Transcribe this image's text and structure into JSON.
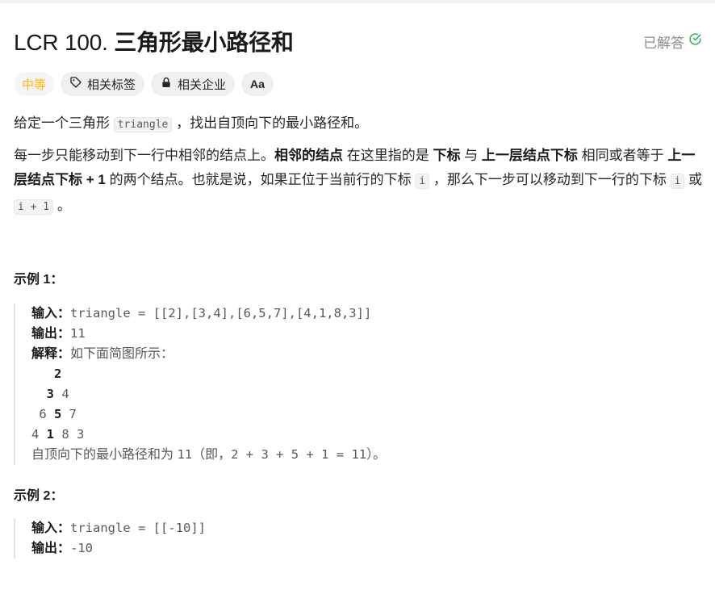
{
  "problem": {
    "number": "LCR 100.",
    "title": "三角形最小路径和",
    "status": "已解答"
  },
  "tags": {
    "difficulty": "中等",
    "related_tags": "相关标签",
    "related_companies": "相关企业",
    "translate_icon": "Aa"
  },
  "description": {
    "p1_pre": "给定一个三角形 ",
    "p1_code": "triangle",
    "p1_post": " ，找出自顶向下的最小路径和。",
    "p2_a": "每一步只能移动到下一行中相邻的结点上。",
    "p2_b": "相邻的结点",
    "p2_c": " 在这里指的是 ",
    "p2_d": "下标",
    "p2_e": " 与 ",
    "p2_f": "上一层结点下标",
    "p2_g": " 相同或者等于 ",
    "p2_h": "上一层结点下标 + 1",
    "p2_i": " 的两个结点。也就是说，如果正位于当前行的下标 ",
    "p2_code1": "i",
    "p2_j": " ，那么下一步可以移动到下一行的下标 ",
    "p2_code2": "i",
    "p2_k": " 或 ",
    "p2_code3": "i + 1",
    "p2_l": " 。"
  },
  "example1": {
    "title": "示例 1：",
    "input_label": "输入：",
    "input_value": "triangle = [[2],[3,4],[6,5,7],[4,1,8,3]]",
    "output_label": "输出：",
    "output_value": "11",
    "explain_label": "解释：",
    "explain_value": "如下面简图所示：",
    "tri_row1_pad": "   ",
    "tri_row1_bold": "2",
    "tri_row2_pad": "  ",
    "tri_row2_bold": "3",
    "tri_row2_rest": " 4",
    "tri_row3_pre": " 6 ",
    "tri_row3_bold": "5",
    "tri_row3_rest": " 7",
    "tri_row4_pre": "4 ",
    "tri_row4_bold": "1",
    "tri_row4_rest": " 8 3",
    "summary_text": "自顶向下的最小路径和为 ",
    "summary_num": "11",
    "summary_paren_open": "（即，",
    "summary_eq": "2 + 3 + 5 + 1 = 11",
    "summary_end": "）。"
  },
  "example2": {
    "title": "示例 2：",
    "input_label": "输入：",
    "input_value": "triangle = [[-10]]",
    "output_label": "输出：",
    "output_value": "-10"
  }
}
